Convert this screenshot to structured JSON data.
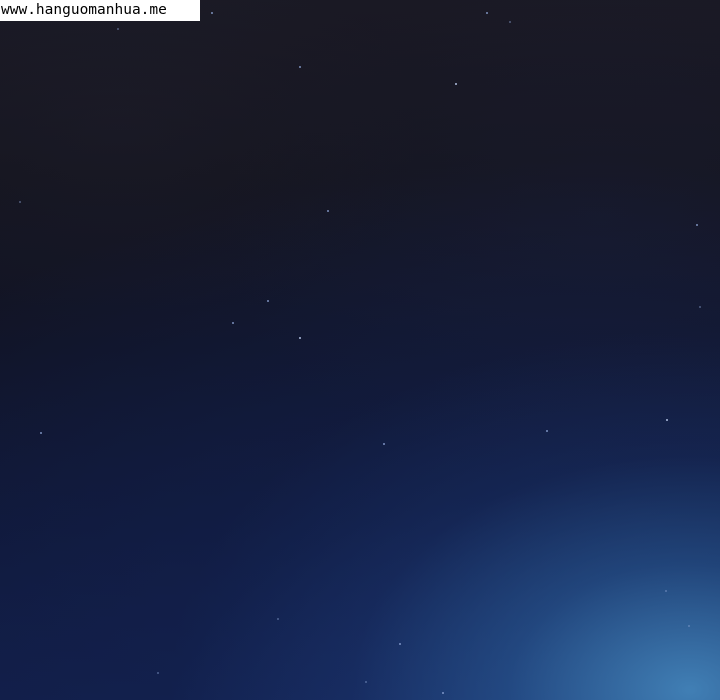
{
  "watermark": {
    "text": "www.hanguomanhua.me"
  },
  "scene": {
    "description_colors": {
      "top": "#1a1924",
      "middle": "#111427",
      "bottom": "#121d45",
      "glow": "#488ec4"
    }
  }
}
